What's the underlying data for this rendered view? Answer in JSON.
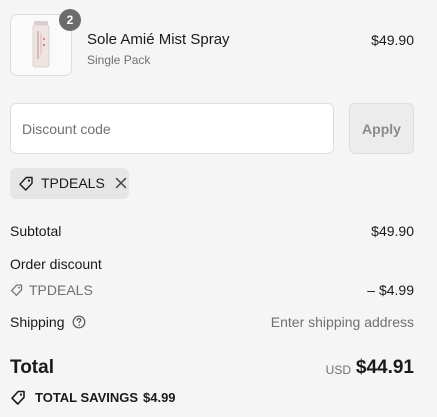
{
  "product": {
    "quantity": "2",
    "name": "Sole Amié Mist Spray",
    "variant": "Single Pack",
    "price": "$49.90",
    "image_icon": "spray-bottle-icon"
  },
  "discount": {
    "placeholder": "Discount code",
    "value": "",
    "apply_label": "Apply",
    "applied_code": "TPDEALS",
    "tag_icon": "tag-icon",
    "remove_icon": "close-icon"
  },
  "summary": {
    "subtotal_label": "Subtotal",
    "subtotal_value": "$49.90",
    "order_discount_label": "Order discount",
    "discount_code": "TPDEALS",
    "discount_amount": "– $4.99",
    "shipping_label": "Shipping",
    "shipping_help_icon": "question-circle-icon",
    "shipping_value": "Enter shipping address",
    "total_label": "Total",
    "total_currency": "USD",
    "total_value": "$44.91",
    "savings_icon": "tag-icon",
    "savings_label": "TOTAL SAVINGS",
    "savings_value": "$4.99"
  },
  "colors": {
    "background": "#f5f5f5",
    "text": "#1a1a1a",
    "muted_text": "#707070",
    "chip_background": "#e6e6e6",
    "button_disabled": "#ececec",
    "badge": "#6b6b6b"
  }
}
